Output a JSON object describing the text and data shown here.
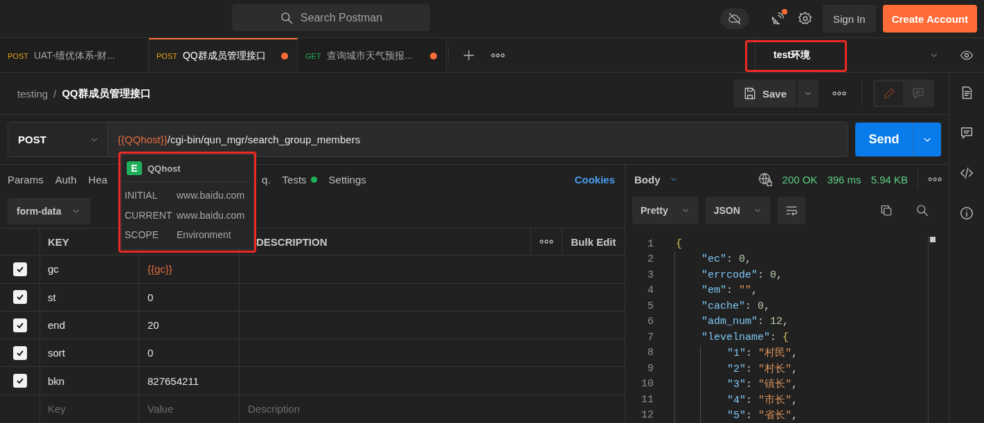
{
  "header": {
    "search_placeholder": "Search Postman",
    "sign_in": "Sign In",
    "create_account": "Create Account"
  },
  "request_tabs": [
    {
      "method": "POST",
      "color": "#e8a317",
      "title": "UAT-绩优体系-财...",
      "unsaved": false,
      "selected": false
    },
    {
      "method": "POST",
      "color": "#e8a317",
      "title": "QQ群成员管理接口",
      "unsaved": true,
      "selected": true
    },
    {
      "method": "GET",
      "color": "#1fb05a",
      "title": "查询城市天气预报...",
      "unsaved": true,
      "selected": false
    }
  ],
  "environment": {
    "name": "test环境"
  },
  "breadcrumb": {
    "collection": "testing",
    "separator": "/",
    "request": "QQ群成员管理接口"
  },
  "save_button": "Save",
  "url": {
    "method": "POST",
    "variable": "{{QQhost}}",
    "path": "/cgi-bin/qun_mgr/search_group_members"
  },
  "send_button": "Send",
  "request_sections": [
    {
      "label": "Params",
      "indicator": false
    },
    {
      "label": "Auth",
      "indicator": false
    },
    {
      "label": "Hea",
      "indicator": false
    },
    {
      "label": "q.",
      "indicator": false
    },
    {
      "label": "Tests",
      "indicator": true
    },
    {
      "label": "Settings",
      "indicator": false
    }
  ],
  "cookies_link": "Cookies",
  "body_type": "form-data",
  "params_table": {
    "columns": [
      "KEY",
      "DESCRIPTION"
    ],
    "bulk_edit": "Bulk Edit",
    "rows": [
      {
        "key": "gc",
        "value": "{{gc}}",
        "kind": "variable",
        "checked": true
      },
      {
        "key": "st",
        "value": "0",
        "kind": "plain",
        "checked": true
      },
      {
        "key": "end",
        "value": "20",
        "kind": "plain",
        "checked": true
      },
      {
        "key": "sort",
        "value": "0",
        "kind": "plain",
        "checked": true
      },
      {
        "key": "bkn",
        "value": "827654211",
        "kind": "plain",
        "checked": true
      }
    ],
    "placeholder_row": {
      "key_placeholder": "Key",
      "value_placeholder": "Value",
      "description_placeholder": "Description"
    }
  },
  "variable_popover": {
    "badge": "E",
    "name": "QQhost",
    "rows": [
      {
        "label": "INITIAL",
        "value": "www.baidu.com"
      },
      {
        "label": "CURRENT",
        "value": "www.baidu.com"
      },
      {
        "label": "SCOPE",
        "value": "Environment"
      }
    ]
  },
  "response": {
    "view": "Body",
    "status": "200 OK",
    "time": "396 ms",
    "size": "5.94 KB",
    "format": "Pretty",
    "language": "JSON",
    "code": [
      {
        "number": "1",
        "parts": [
          {
            "kind": "bracket",
            "text": "{"
          }
        ],
        "children": [
          {
            "number": "2",
            "parts": [
              {
                "kind": "key",
                "text": "\"ec\""
              },
              {
                "kind": "punct",
                "text": ":"
              },
              {
                "kind": "number",
                "text": "0"
              },
              {
                "kind": "punct",
                "text": ","
              }
            ]
          },
          {
            "number": "3",
            "parts": [
              {
                "kind": "key",
                "text": "\"errcode\""
              },
              {
                "kind": "punct",
                "text": ":"
              },
              {
                "kind": "number",
                "text": "0"
              },
              {
                "kind": "punct",
                "text": ","
              }
            ]
          },
          {
            "number": "4",
            "parts": [
              {
                "kind": "key",
                "text": "\"em\""
              },
              {
                "kind": "punct",
                "text": ":"
              },
              {
                "kind": "string",
                "text": "\"\""
              },
              {
                "kind": "punct",
                "text": ","
              }
            ]
          },
          {
            "number": "5",
            "parts": [
              {
                "kind": "key",
                "text": "\"cache\""
              },
              {
                "kind": "punct",
                "text": ":"
              },
              {
                "kind": "number",
                "text": "0"
              },
              {
                "kind": "punct",
                "text": ","
              }
            ]
          },
          {
            "number": "6",
            "parts": [
              {
                "kind": "key",
                "text": "\"adm_num\""
              },
              {
                "kind": "punct",
                "text": ":"
              },
              {
                "kind": "number",
                "text": "12"
              },
              {
                "kind": "punct",
                "text": ","
              }
            ]
          },
          {
            "number": "7",
            "parts": [
              {
                "kind": "key",
                "text": "\"levelname\""
              },
              {
                "kind": "punct",
                "text": ":"
              },
              {
                "kind": "bracket",
                "text": "{"
              }
            ],
            "children": [
              {
                "number": "8",
                "parts": [
                  {
                    "kind": "key",
                    "text": "\"1\""
                  },
                  {
                    "kind": "punct",
                    "text": ":"
                  },
                  {
                    "kind": "string",
                    "text": "\"村民\""
                  },
                  {
                    "kind": "punct",
                    "text": ","
                  }
                ]
              },
              {
                "number": "9",
                "parts": [
                  {
                    "kind": "key",
                    "text": "\"2\""
                  },
                  {
                    "kind": "punct",
                    "text": ":"
                  },
                  {
                    "kind": "string",
                    "text": "\"村长\""
                  },
                  {
                    "kind": "punct",
                    "text": ","
                  }
                ]
              },
              {
                "number": "10",
                "parts": [
                  {
                    "kind": "key",
                    "text": "\"3\""
                  },
                  {
                    "kind": "punct",
                    "text": ":"
                  },
                  {
                    "kind": "string",
                    "text": "\"镇长\""
                  },
                  {
                    "kind": "punct",
                    "text": ","
                  }
                ]
              },
              {
                "number": "11",
                "parts": [
                  {
                    "kind": "key",
                    "text": "\"4\""
                  },
                  {
                    "kind": "punct",
                    "text": ":"
                  },
                  {
                    "kind": "string",
                    "text": "\"市长\""
                  },
                  {
                    "kind": "punct",
                    "text": ","
                  }
                ]
              },
              {
                "number": "12",
                "parts": [
                  {
                    "kind": "key",
                    "text": "\"5\""
                  },
                  {
                    "kind": "punct",
                    "text": ":"
                  },
                  {
                    "kind": "string",
                    "text": "\"省长\""
                  },
                  {
                    "kind": "punct",
                    "text": ","
                  }
                ]
              }
            ]
          }
        ]
      }
    ]
  }
}
